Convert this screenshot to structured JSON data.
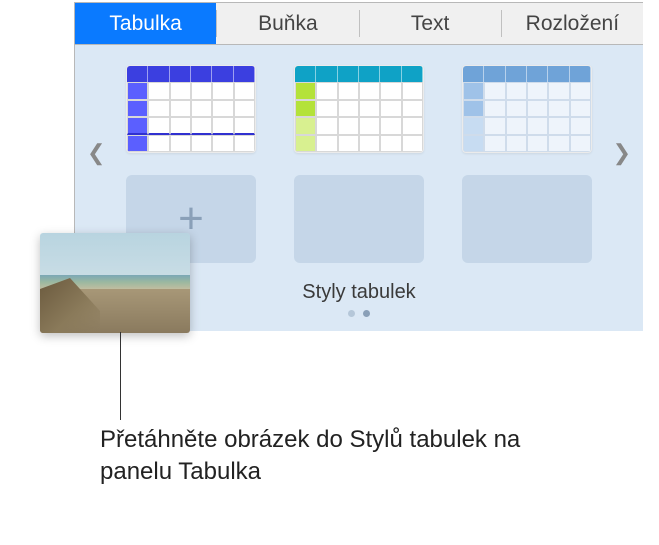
{
  "tabs": {
    "table": "Tabulka",
    "cell": "Buňka",
    "text": "Text",
    "arrange": "Rozložení"
  },
  "styles": {
    "title": "Styly tabulek",
    "thumbs": [
      {
        "id": "style-blue-purple",
        "header_color": "#3b3fe0",
        "accent": "#5b5fff",
        "body": "#ffffff",
        "grid": "#d4d4d4"
      },
      {
        "id": "style-teal-lime",
        "header_color": "#0fa2c6",
        "accent": "#b4e23a",
        "body": "#ffffff",
        "grid": "#d0d0d0"
      },
      {
        "id": "style-soft-blue",
        "header_color": "#6fa3d8",
        "accent": "#9fc2e8",
        "body": "#eef4fb",
        "grid": "#cfdceb"
      }
    ],
    "pages": 2,
    "active_page": 1
  },
  "drag": {
    "alt": "beach-photo"
  },
  "callout": {
    "text": "Přetáhněte obrázek do Stylů tabulek na panelu Tabulka"
  }
}
